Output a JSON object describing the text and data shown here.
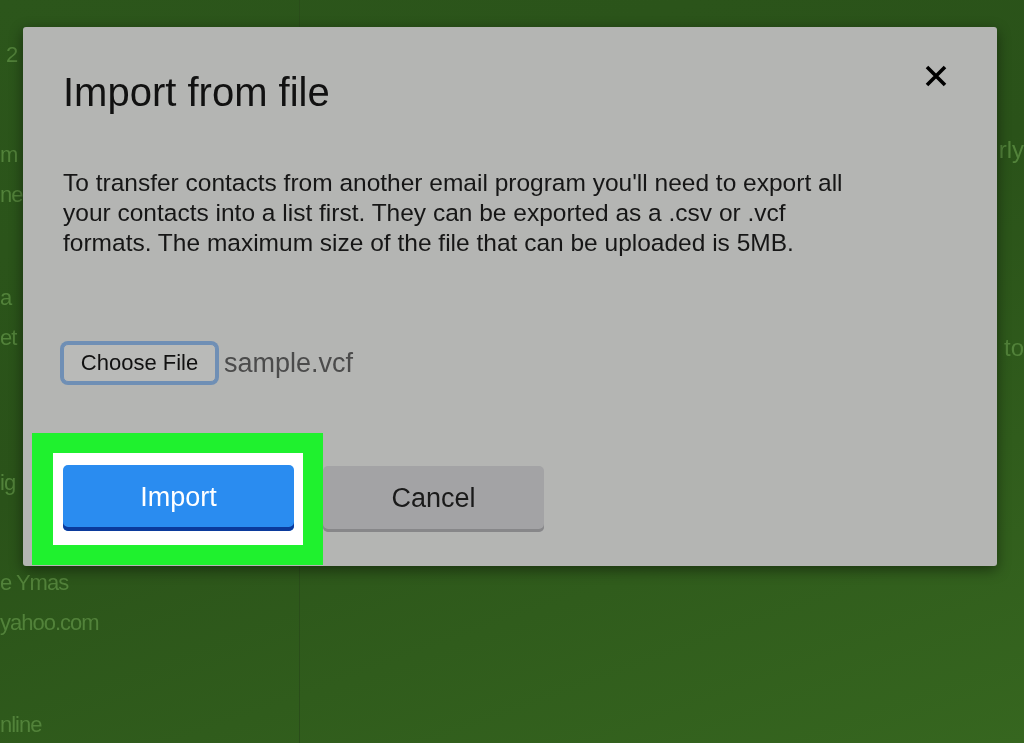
{
  "background_page": {
    "left_fragments": [
      "2",
      "m",
      "ne",
      "a",
      "et",
      "ig",
      "e Ymas",
      "yahoo.com",
      "nline"
    ],
    "right_fragments": [
      "rly",
      "to"
    ]
  },
  "dialog": {
    "title": "Import from file",
    "message": "To transfer contacts from another email program you'll need to export all your contacts into a list first. They can be exported as a .csv or .vcf formats. The maximum size of the file that can be uploaded is 5MB.",
    "file_input": {
      "button": "Choose File",
      "value": "sample.vcf",
      "focused": true
    },
    "buttons": [
      {
        "label": "Import",
        "kind": "primary",
        "highlighted": true
      },
      {
        "label": "Cancel",
        "kind": "secondary",
        "highlighted": false
      }
    ]
  }
}
